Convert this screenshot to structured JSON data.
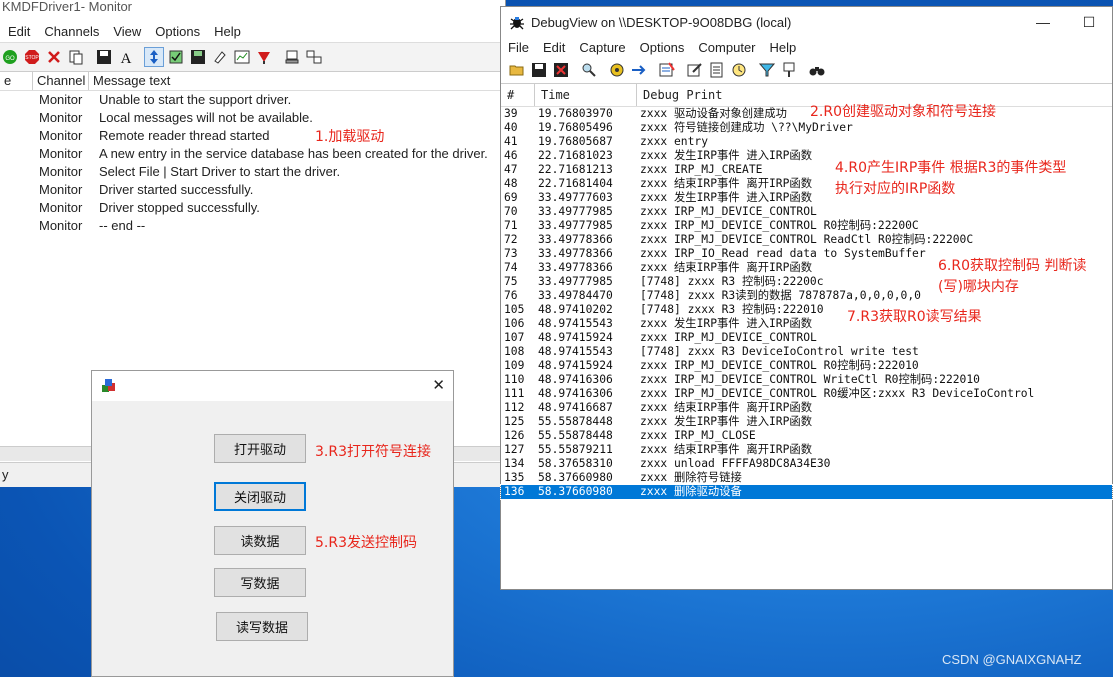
{
  "monitor": {
    "title": "KMDFDriver1- Monitor",
    "menu": [
      "Edit",
      "Channels",
      "View",
      "Options",
      "Help"
    ],
    "columns": [
      "e",
      "Channel",
      "Message text"
    ],
    "rows": [
      {
        "channel": "Monitor",
        "text": "Unable to start the support driver."
      },
      {
        "channel": "Monitor",
        "text": "Local messages will not be available."
      },
      {
        "channel": "Monitor",
        "text": "Remote reader thread started"
      },
      {
        "channel": "Monitor",
        "text": "A new entry in the service database has been created for the driver."
      },
      {
        "channel": "Monitor",
        "text": "Select File | Start Driver to start the driver."
      },
      {
        "channel": "Monitor",
        "text": "Driver started successfully."
      },
      {
        "channel": "Monitor",
        "text": "Driver stopped successfully."
      },
      {
        "channel": "Monitor",
        "text": " -- end --"
      }
    ],
    "status": "y"
  },
  "debugview": {
    "title": "DebugView on \\\\DESKTOP-9O08DBG (local)",
    "menu": [
      "File",
      "Edit",
      "Capture",
      "Options",
      "Computer",
      "Help"
    ],
    "columns": [
      "#",
      "Time",
      "Debug Print"
    ],
    "rows": [
      {
        "n": "39",
        "t": "19.76803970",
        "m": "zxxx 驱动设备对象创建成功"
      },
      {
        "n": "40",
        "t": "19.76805496",
        "m": "zxxx 符号链接创建成功 \\??\\MyDriver"
      },
      {
        "n": "41",
        "t": "19.76805687",
        "m": "zxxx entry"
      },
      {
        "n": "46",
        "t": "22.71681023",
        "m": "zxxx 发生IRP事件 进入IRP函数"
      },
      {
        "n": "47",
        "t": "22.71681213",
        "m": "zxxx IRP_MJ_CREATE"
      },
      {
        "n": "48",
        "t": "22.71681404",
        "m": "zxxx 结束IRP事件 离开IRP函数"
      },
      {
        "n": "69",
        "t": "33.49777603",
        "m": "zxxx 发生IRP事件 进入IRP函数"
      },
      {
        "n": "70",
        "t": "33.49777985",
        "m": "zxxx IRP_MJ_DEVICE_CONTROL"
      },
      {
        "n": "71",
        "t": "33.49777985",
        "m": "zxxx IRP_MJ_DEVICE_CONTROL R0控制码:22200C"
      },
      {
        "n": "72",
        "t": "33.49778366",
        "m": "zxxx IRP_MJ_DEVICE_CONTROL ReadCtl R0控制码:22200C"
      },
      {
        "n": "73",
        "t": "33.49778366",
        "m": "zxxx IRP_IO_Read read data to SystemBuffer"
      },
      {
        "n": "74",
        "t": "33.49778366",
        "m": "zxxx 结束IRP事件 离开IRP函数"
      },
      {
        "n": "75",
        "t": "33.49777985",
        "m": "[7748] zxxx R3 控制码:22200c"
      },
      {
        "n": "76",
        "t": "33.49784470",
        "m": "[7748] zxxx R3读到的数据 7878787a,0,0,0,0,0"
      },
      {
        "n": "105",
        "t": "48.97410202",
        "m": "[7748] zxxx R3 控制码:222010"
      },
      {
        "n": "106",
        "t": "48.97415543",
        "m": "zxxx 发生IRP事件 进入IRP函数"
      },
      {
        "n": "107",
        "t": "48.97415924",
        "m": "zxxx IRP_MJ_DEVICE_CONTROL"
      },
      {
        "n": "108",
        "t": "48.97415543",
        "m": "[7748] zxxx R3 DeviceIoControl write test"
      },
      {
        "n": "109",
        "t": "48.97415924",
        "m": "zxxx IRP_MJ_DEVICE_CONTROL R0控制码:222010"
      },
      {
        "n": "110",
        "t": "48.97416306",
        "m": "zxxx IRP_MJ_DEVICE_CONTROL WriteCtl R0控制码:222010"
      },
      {
        "n": "111",
        "t": "48.97416306",
        "m": "zxxx IRP_MJ_DEVICE_CONTROL R0缓冲区:zxxx R3 DeviceIoControl"
      },
      {
        "n": "112",
        "t": "48.97416687",
        "m": "zxxx 结束IRP事件 离开IRP函数"
      },
      {
        "n": "125",
        "t": "55.55878448",
        "m": "zxxx 发生IRP事件 进入IRP函数"
      },
      {
        "n": "126",
        "t": "55.55878448",
        "m": "zxxx IRP_MJ_CLOSE"
      },
      {
        "n": "127",
        "t": "55.55879211",
        "m": "zxxx 结束IRP事件 离开IRP函数"
      },
      {
        "n": "134",
        "t": "58.37658310",
        "m": "zxxx unload  FFFFA98DC8A34E30"
      },
      {
        "n": "135",
        "t": "58.37660980",
        "m": "zxxx 删除符号链接"
      },
      {
        "n": "136",
        "t": "58.37660980",
        "m": "zxxx 删除驱动设备"
      }
    ],
    "selected_index": 27
  },
  "annotations": {
    "a1": "1.加载驱动",
    "a2": "2.R0创建驱动对象和符号连接",
    "a3": "3.R3打开符号连接",
    "a4_line1": "4.R0产生IRP事件 根据R3的事件类型",
    "a4_line2": "执行对应的IRP函数",
    "a5": "5.R3发送控制码",
    "a6_line1": "6.R0获取控制码 判断读",
    "a6_line2": "(写)哪块内存",
    "a7": "7.R3获取R0读写结果"
  },
  "dialog": {
    "buttons": {
      "open": "打开驱动",
      "close": "关闭驱动",
      "read": "读数据",
      "write": "写数据",
      "readwrite": "读写数据"
    }
  },
  "watermark": "CSDN @GNAIXGNAHZ",
  "colors": {
    "annotation": "#e8261c",
    "selection": "#0078d7"
  }
}
